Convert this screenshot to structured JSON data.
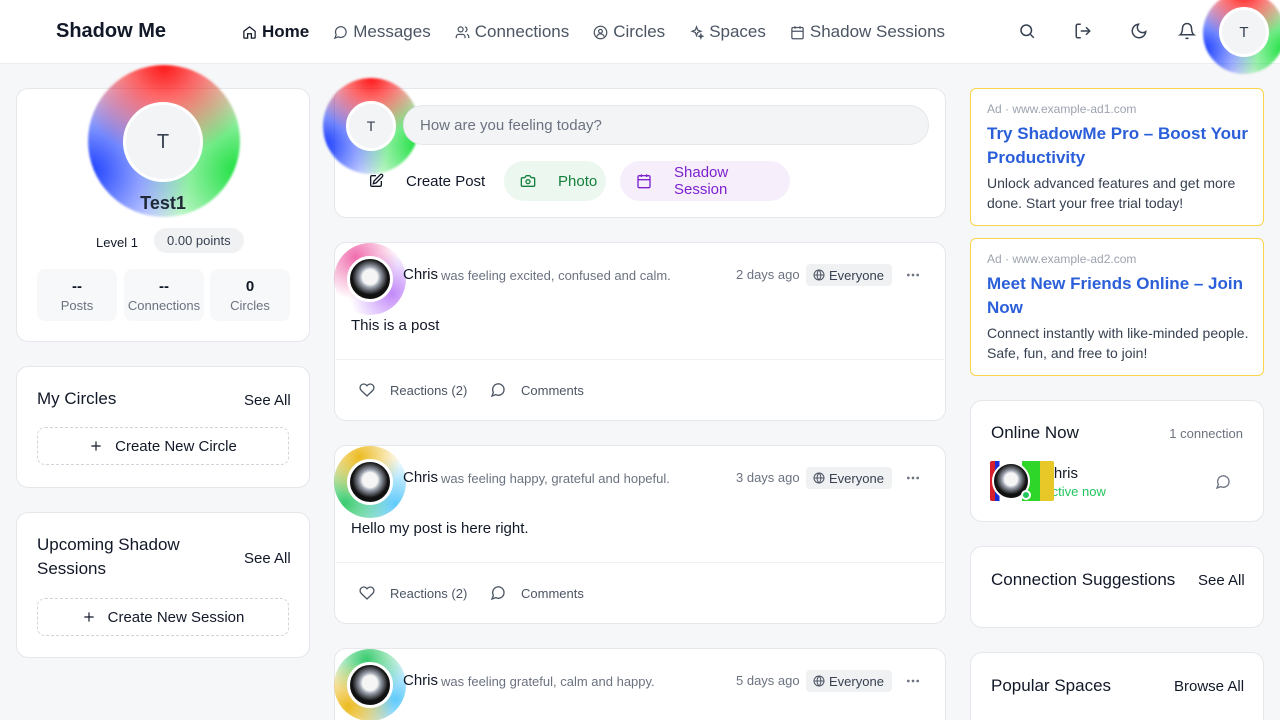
{
  "app": {
    "title": "Shadow Me"
  },
  "nav": [
    {
      "label": "Home",
      "icon": "home-icon",
      "active": true
    },
    {
      "label": "Messages",
      "icon": "message-icon"
    },
    {
      "label": "Connections",
      "icon": "users-icon"
    },
    {
      "label": "Circles",
      "icon": "circle-user-icon"
    },
    {
      "label": "Spaces",
      "icon": "sparkles-icon"
    },
    {
      "label": "Shadow Sessions",
      "icon": "calendar-icon"
    }
  ],
  "header_icons": [
    "search-icon",
    "logout-icon",
    "moon-icon",
    "bell-icon"
  ],
  "user": {
    "initial": "T",
    "name": "Test1",
    "level": "Level 1",
    "points": "0.00 points"
  },
  "stats": [
    {
      "value": "--",
      "label": "Posts"
    },
    {
      "value": "--",
      "label": "Connections"
    },
    {
      "value": "0",
      "label": "Circles"
    }
  ],
  "circles": {
    "title": "My Circles",
    "see_all": "See All",
    "create": "Create New Circle"
  },
  "sessions": {
    "title": "Upcoming Shadow Sessions",
    "see_all": "See All",
    "create": "Create New Session"
  },
  "composer": {
    "placeholder": "How are you feeling today?",
    "create_post": "Create Post",
    "photo": "Photo",
    "shadow_session": "Shadow Session"
  },
  "posts": [
    {
      "author": "Chris",
      "feeling": "was feeling excited, confused and calm.",
      "time": "2 days ago",
      "audience": "Everyone",
      "body": "This is a post",
      "reactions": "Reactions (2)",
      "comments": "Comments"
    },
    {
      "author": "Chris",
      "feeling": "was feeling happy, grateful and hopeful.",
      "time": "3 days ago",
      "audience": "Everyone",
      "body": "Hello my post is here right.",
      "reactions": "Reactions (2)",
      "comments": "Comments"
    },
    {
      "author": "Chris",
      "feeling": "was feeling grateful, calm and happy.",
      "time": "5 days ago",
      "audience": "Everyone"
    }
  ],
  "ads": [
    {
      "source": "Ad · www.example-ad1.com",
      "title": "Try ShadowMe Pro – Boost Your Productivity",
      "desc": "Unlock advanced features and get more done. Start your free trial today!"
    },
    {
      "source": "Ad · www.example-ad2.com",
      "title": "Meet New Friends Online – Join Now",
      "desc": "Connect instantly with like-minded people. Safe, fun, and free to join!"
    }
  ],
  "online": {
    "title": "Online Now",
    "count": "1 connection",
    "name": "Chris",
    "status": "Active now"
  },
  "suggestions": {
    "title": "Connection Suggestions",
    "see_all": "See All"
  },
  "spaces": {
    "title": "Popular Spaces",
    "browse": "Browse All"
  },
  "colors": {
    "accent_blue": "#2b5fd9",
    "photo_green": "#15803d",
    "session_purple": "#7e22ce",
    "online_green": "#22c55e",
    "ad_border": "#fcd34d"
  }
}
